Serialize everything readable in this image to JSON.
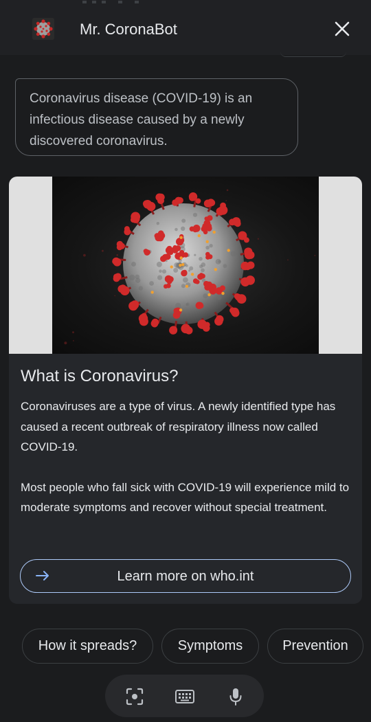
{
  "header": {
    "title": "Mr. CoronaBot",
    "avatar_icon": "coronavirus-avatar-icon",
    "close_icon": "close-icon"
  },
  "bot_message": {
    "text": "Coronavirus disease (COVID-19) is an infectious disease caused by a newly discovered coronavirus."
  },
  "card": {
    "image_icon": "coronavirus-illustration",
    "title": "What is Coronavirus?",
    "paragraphs": [
      "Coronaviruses are a type of virus. A newly identified type has caused a recent outbreak of respiratory illness now called COVID-19.",
      "Most people who fall sick with COVID-19 will experience mild to moderate symptoms and recover without special treatment."
    ],
    "button": {
      "label": "Learn more on who.int",
      "icon": "arrow-right-icon"
    }
  },
  "suggestions": [
    {
      "label": "How it spreads?"
    },
    {
      "label": "Symptoms"
    },
    {
      "label": "Prevention"
    }
  ],
  "input_bar": {
    "icons": [
      "lens-icon",
      "keyboard-icon",
      "microphone-icon"
    ]
  },
  "colors": {
    "background": "#1b1c1e",
    "card": "#25272b",
    "accent_blue": "#8ab4f8",
    "button_border": "#aecbfa",
    "virus_red": "#d02a2a"
  }
}
